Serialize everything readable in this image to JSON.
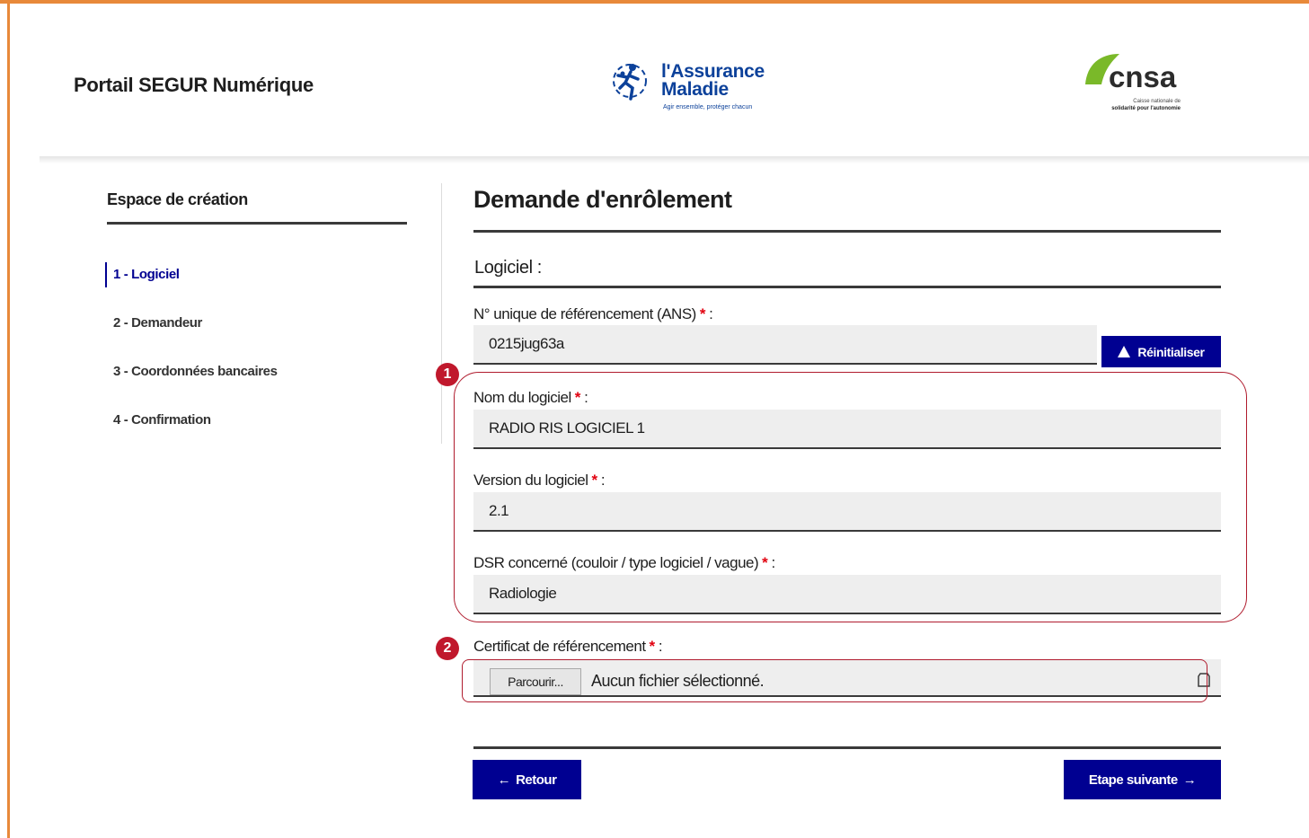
{
  "header": {
    "portal_title": "Portail SEGUR Numérique",
    "assurance_logo": {
      "line1": "l'Assurance",
      "line2": "Maladie",
      "tagline": "Agir ensemble, protéger chacun"
    },
    "cnsa_logo": {
      "word": "cnsa",
      "sub1": "Caisse nationale de",
      "sub2": "solidarité pour l'autonomie"
    }
  },
  "sidebar": {
    "title": "Espace de création",
    "steps": [
      {
        "label": "1 - Logiciel",
        "active": true
      },
      {
        "label": "2 - Demandeur",
        "active": false
      },
      {
        "label": "3 - Coordonnées bancaires",
        "active": false
      },
      {
        "label": "4 - Confirmation",
        "active": false
      }
    ]
  },
  "main": {
    "title": "Demande d'enrôlement",
    "section_title": "Logiciel :",
    "required_marker": "*",
    "fields": {
      "ref_number": {
        "label": "N° unique de référencement (ANS)",
        "value": "0215jug63a"
      },
      "software_name": {
        "label": "Nom du logiciel",
        "value": "RADIO RIS LOGICIEL 1"
      },
      "software_version": {
        "label": "Version du logiciel",
        "value": "2.1"
      },
      "dsr": {
        "label": "DSR concerné (couloir / type logiciel / vague)",
        "value": "Radiologie"
      },
      "certificate": {
        "label": "Certificat de référencement",
        "browse_label": "Parcourir...",
        "status": "Aucun fichier sélectionné."
      }
    },
    "reset_button": "Réinitialiser",
    "back_button": "Retour",
    "next_button": "Etape suivante"
  },
  "annotations": {
    "badge1": "1",
    "badge2": "2"
  },
  "colors": {
    "primary": "#000091",
    "required": "#e1000f",
    "annotation": "#c0182c",
    "frame": "#e8893a"
  },
  "icons": {
    "reset": "warning-triangle-icon",
    "back": "arrow-left-icon",
    "next": "arrow-right-icon"
  }
}
